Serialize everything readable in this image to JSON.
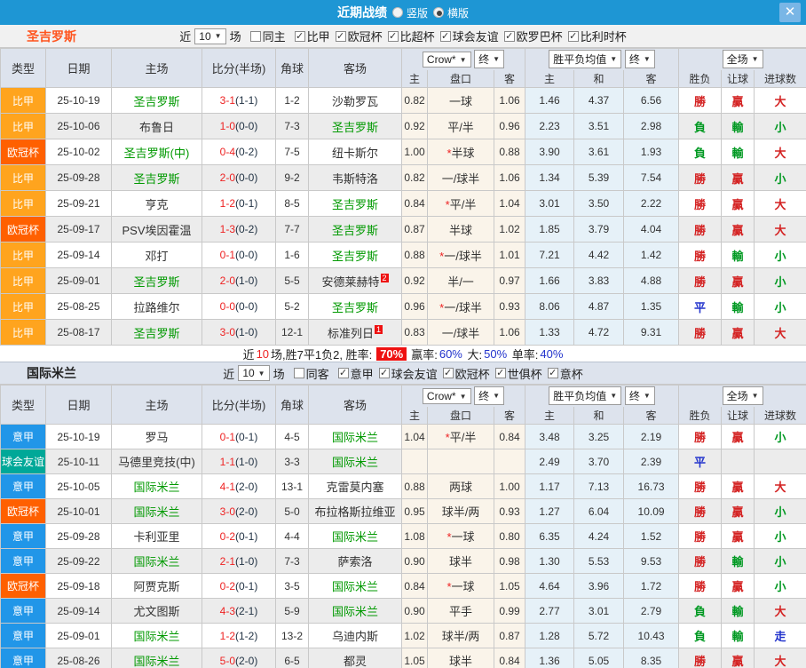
{
  "titlebar": {
    "title": "近期战绩",
    "radios": [
      {
        "label": "竖版",
        "selected": false
      },
      {
        "label": "横版",
        "selected": true
      }
    ],
    "close_label": "✕"
  },
  "filter_labels": {
    "near": "近",
    "matches": "场"
  },
  "header": {
    "type": "类型",
    "date": "日期",
    "home": "主场",
    "score": "比分(半场)",
    "corner": "角球",
    "away": "客场",
    "crow_select": "Crow*",
    "crow_final": "终",
    "avg_select": "胜平负均值",
    "avg_final": "终",
    "scope_select": "全场",
    "h": "主",
    "handicap": "盘口",
    "a": "客",
    "avg_h": "主",
    "avg_d": "和",
    "avg_a": "客",
    "result": "胜负",
    "let_ball": "让球",
    "goals": "进球数"
  },
  "type_colors": {
    "比甲": "#ffa41e",
    "欧冠杯": "#ff6000",
    "意甲": "#2196e8",
    "球会友谊": "#00a898"
  },
  "result_colors": {
    "勝": "c-red",
    "負": "c-green",
    "平": "c-blue",
    "贏": "c-red",
    "輸": "c-green",
    "大": "c-red",
    "小": "c-green",
    "走": "c-blue"
  },
  "sections": [
    {
      "team": "圣吉罗斯",
      "team_style": "orange",
      "count": "10",
      "same_label": "同主",
      "same_checked": false,
      "leagues": [
        "比甲",
        "欧冠杯",
        "比超杯",
        "球会友谊",
        "欧罗巴杯",
        "比利时杯"
      ],
      "rows": [
        {
          "type": "比甲",
          "date": "25-10-19",
          "home": "圣吉罗斯",
          "home_focus": true,
          "score": "3-1",
          "half": "(1-1)",
          "corner": "1-2",
          "away": "沙勒罗瓦",
          "away_focus": false,
          "away_badge": "",
          "ch": "0.82",
          "hc": "一球",
          "ca": "1.06",
          "ah": "1.46",
          "ad": "4.37",
          "aa": "6.56",
          "r1": "勝",
          "r2": "贏",
          "r3": "大"
        },
        {
          "type": "比甲",
          "date": "25-10-06",
          "home": "布鲁日",
          "home_focus": false,
          "score": "1-0",
          "half": "(0-0)",
          "corner": "7-3",
          "away": "圣吉罗斯",
          "away_focus": true,
          "away_badge": "",
          "ch": "0.92",
          "hc": "平/半",
          "ca": "0.96",
          "ah": "2.23",
          "ad": "3.51",
          "aa": "2.98",
          "r1": "負",
          "r2": "輸",
          "r3": "小"
        },
        {
          "type": "欧冠杯",
          "date": "25-10-02",
          "home": "圣吉罗斯(中)",
          "home_focus": true,
          "score": "0-4",
          "half": "(0-2)",
          "corner": "7-5",
          "away": "纽卡斯尔",
          "away_focus": false,
          "away_badge": "",
          "ch": "1.00",
          "hc": "*半球",
          "ca": "0.88",
          "ah": "3.90",
          "ad": "3.61",
          "aa": "1.93",
          "r1": "負",
          "r2": "輸",
          "r3": "大"
        },
        {
          "type": "比甲",
          "date": "25-09-28",
          "home": "圣吉罗斯",
          "home_focus": true,
          "score": "2-0",
          "half": "(0-0)",
          "corner": "9-2",
          "away": "韦斯特洛",
          "away_focus": false,
          "away_badge": "",
          "ch": "0.82",
          "hc": "一/球半",
          "ca": "1.06",
          "ah": "1.34",
          "ad": "5.39",
          "aa": "7.54",
          "r1": "勝",
          "r2": "贏",
          "r3": "小"
        },
        {
          "type": "比甲",
          "date": "25-09-21",
          "home": "亨克",
          "home_focus": false,
          "score": "1-2",
          "half": "(0-1)",
          "corner": "8-5",
          "away": "圣吉罗斯",
          "away_focus": true,
          "away_badge": "",
          "ch": "0.84",
          "hc": "*平/半",
          "ca": "1.04",
          "ah": "3.01",
          "ad": "3.50",
          "aa": "2.22",
          "r1": "勝",
          "r2": "贏",
          "r3": "大"
        },
        {
          "type": "欧冠杯",
          "date": "25-09-17",
          "home": "PSV埃因霍温",
          "home_focus": false,
          "score": "1-3",
          "half": "(0-2)",
          "corner": "7-7",
          "away": "圣吉罗斯",
          "away_focus": true,
          "away_badge": "",
          "ch": "0.87",
          "hc": "半球",
          "ca": "1.02",
          "ah": "1.85",
          "ad": "3.79",
          "aa": "4.04",
          "r1": "勝",
          "r2": "贏",
          "r3": "大"
        },
        {
          "type": "比甲",
          "date": "25-09-14",
          "home": "邓打",
          "home_focus": false,
          "score": "0-1",
          "half": "(0-0)",
          "corner": "1-6",
          "away": "圣吉罗斯",
          "away_focus": true,
          "away_badge": "",
          "ch": "0.88",
          "hc": "*一/球半",
          "ca": "1.01",
          "ah": "7.21",
          "ad": "4.42",
          "aa": "1.42",
          "r1": "勝",
          "r2": "輸",
          "r3": "小"
        },
        {
          "type": "比甲",
          "date": "25-09-01",
          "home": "圣吉罗斯",
          "home_focus": true,
          "score": "2-0",
          "half": "(1-0)",
          "corner": "5-5",
          "away": "安德莱赫特",
          "away_focus": false,
          "away_badge": "2",
          "ch": "0.92",
          "hc": "半/一",
          "ca": "0.97",
          "ah": "1.66",
          "ad": "3.83",
          "aa": "4.88",
          "r1": "勝",
          "r2": "贏",
          "r3": "小"
        },
        {
          "type": "比甲",
          "date": "25-08-25",
          "home": "拉路维尔",
          "home_focus": false,
          "score": "0-0",
          "half": "(0-0)",
          "corner": "5-2",
          "away": "圣吉罗斯",
          "away_focus": true,
          "away_badge": "",
          "ch": "0.96",
          "hc": "*一/球半",
          "ca": "0.93",
          "ah": "8.06",
          "ad": "4.87",
          "aa": "1.35",
          "r1": "平",
          "r2": "輸",
          "r3": "小"
        },
        {
          "type": "比甲",
          "date": "25-08-17",
          "home": "圣吉罗斯",
          "home_focus": true,
          "score": "3-0",
          "half": "(1-0)",
          "corner": "12-1",
          "away": "标准列日",
          "away_focus": false,
          "away_badge": "1",
          "ch": "0.83",
          "hc": "一/球半",
          "ca": "1.06",
          "ah": "1.33",
          "ad": "4.72",
          "aa": "9.31",
          "r1": "勝",
          "r2": "贏",
          "r3": "大"
        }
      ],
      "summary": {
        "pre": "近",
        "count": "10",
        "mid": "场,胜7平1负2, 胜率:",
        "win_rate": "70%",
        "seg2": "赢率:",
        "win_pct": "60%",
        "seg3": "大:",
        "big_pct": "50%",
        "seg4": "单率:",
        "single_pct": "40%"
      }
    },
    {
      "team": "国际米兰",
      "team_style": "dark",
      "count": "10",
      "same_label": "同客",
      "same_checked": false,
      "leagues": [
        "意甲",
        "球会友谊",
        "欧冠杯",
        "世俱杯",
        "意杯"
      ],
      "rows": [
        {
          "type": "意甲",
          "date": "25-10-19",
          "home": "罗马",
          "home_focus": false,
          "score": "0-1",
          "half": "(0-1)",
          "corner": "4-5",
          "away": "国际米兰",
          "away_focus": true,
          "away_badge": "",
          "ch": "1.04",
          "hc": "*平/半",
          "ca": "0.84",
          "ah": "3.48",
          "ad": "3.25",
          "aa": "2.19",
          "r1": "勝",
          "r2": "贏",
          "r3": "小"
        },
        {
          "type": "球会友谊",
          "date": "25-10-11",
          "home": "马德里竞技(中)",
          "home_focus": false,
          "score": "1-1",
          "half": "(1-0)",
          "corner": "3-3",
          "away": "国际米兰",
          "away_focus": true,
          "away_badge": "",
          "ch": "",
          "hc": "",
          "ca": "",
          "ah": "2.49",
          "ad": "3.70",
          "aa": "2.39",
          "r1": "平",
          "r2": "",
          "r3": ""
        },
        {
          "type": "意甲",
          "date": "25-10-05",
          "home": "国际米兰",
          "home_focus": true,
          "score": "4-1",
          "half": "(2-0)",
          "corner": "13-1",
          "away": "克雷莫内塞",
          "away_focus": false,
          "away_badge": "",
          "ch": "0.88",
          "hc": "两球",
          "ca": "1.00",
          "ah": "1.17",
          "ad": "7.13",
          "aa": "16.73",
          "r1": "勝",
          "r2": "贏",
          "r3": "大"
        },
        {
          "type": "欧冠杯",
          "date": "25-10-01",
          "home": "国际米兰",
          "home_focus": true,
          "score": "3-0",
          "half": "(2-0)",
          "corner": "5-0",
          "away": "布拉格斯拉维亚",
          "away_focus": false,
          "away_badge": "",
          "ch": "0.95",
          "hc": "球半/两",
          "ca": "0.93",
          "ah": "1.27",
          "ad": "6.04",
          "aa": "10.09",
          "r1": "勝",
          "r2": "贏",
          "r3": "小"
        },
        {
          "type": "意甲",
          "date": "25-09-28",
          "home": "卡利亚里",
          "home_focus": false,
          "score": "0-2",
          "half": "(0-1)",
          "corner": "4-4",
          "away": "国际米兰",
          "away_focus": true,
          "away_badge": "",
          "ch": "1.08",
          "hc": "*一球",
          "ca": "0.80",
          "ah": "6.35",
          "ad": "4.24",
          "aa": "1.52",
          "r1": "勝",
          "r2": "贏",
          "r3": "小"
        },
        {
          "type": "意甲",
          "date": "25-09-22",
          "home": "国际米兰",
          "home_focus": true,
          "score": "2-1",
          "half": "(1-0)",
          "corner": "7-3",
          "away": "萨索洛",
          "away_focus": false,
          "away_badge": "",
          "ch": "0.90",
          "hc": "球半",
          "ca": "0.98",
          "ah": "1.30",
          "ad": "5.53",
          "aa": "9.53",
          "r1": "勝",
          "r2": "輸",
          "r3": "小"
        },
        {
          "type": "欧冠杯",
          "date": "25-09-18",
          "home": "阿贾克斯",
          "home_focus": false,
          "score": "0-2",
          "half": "(0-1)",
          "corner": "3-5",
          "away": "国际米兰",
          "away_focus": true,
          "away_badge": "",
          "ch": "0.84",
          "hc": "*一球",
          "ca": "1.05",
          "ah": "4.64",
          "ad": "3.96",
          "aa": "1.72",
          "r1": "勝",
          "r2": "贏",
          "r3": "小"
        },
        {
          "type": "意甲",
          "date": "25-09-14",
          "home": "尤文图斯",
          "home_focus": false,
          "score": "4-3",
          "half": "(2-1)",
          "corner": "5-9",
          "away": "国际米兰",
          "away_focus": true,
          "away_badge": "",
          "ch": "0.90",
          "hc": "平手",
          "ca": "0.99",
          "ah": "2.77",
          "ad": "3.01",
          "aa": "2.79",
          "r1": "負",
          "r2": "輸",
          "r3": "大"
        },
        {
          "type": "意甲",
          "date": "25-09-01",
          "home": "国际米兰",
          "home_focus": true,
          "score": "1-2",
          "half": "(1-2)",
          "corner": "13-2",
          "away": "乌迪内斯",
          "away_focus": false,
          "away_badge": "",
          "ch": "1.02",
          "hc": "球半/两",
          "ca": "0.87",
          "ah": "1.28",
          "ad": "5.72",
          "aa": "10.43",
          "r1": "負",
          "r2": "輸",
          "r3": "走"
        },
        {
          "type": "意甲",
          "date": "25-08-26",
          "home": "国际米兰",
          "home_focus": true,
          "score": "5-0",
          "half": "(2-0)",
          "corner": "6-5",
          "away": "都灵",
          "away_focus": false,
          "away_badge": "",
          "ch": "1.05",
          "hc": "球半",
          "ca": "0.84",
          "ah": "1.36",
          "ad": "5.05",
          "aa": "8.35",
          "r1": "勝",
          "r2": "贏",
          "r3": "大"
        }
      ]
    }
  ]
}
